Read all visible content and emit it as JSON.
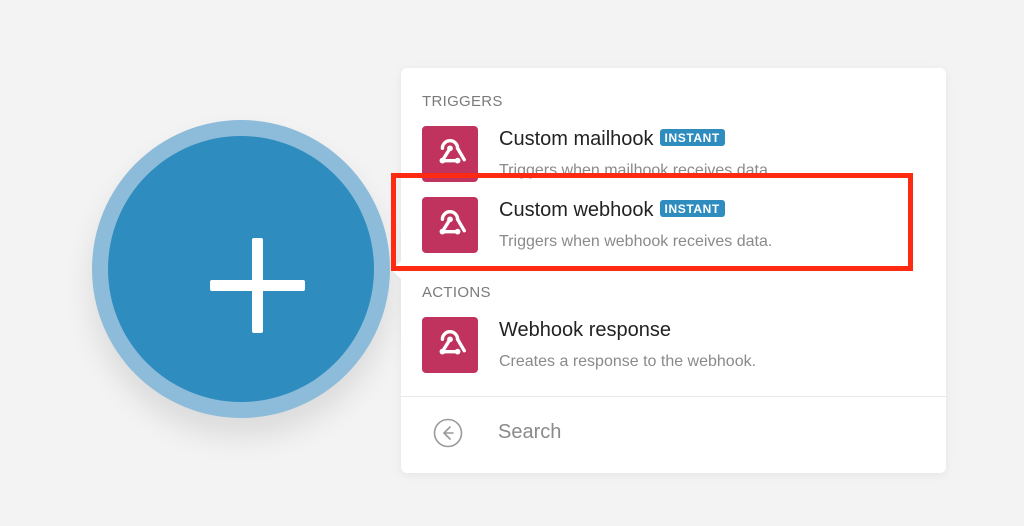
{
  "add_button": {
    "icon": "plus-icon"
  },
  "menu": {
    "triggers_label": "TRIGGERS",
    "actions_label": "ACTIONS",
    "triggers": [
      {
        "title": "Custom mailhook",
        "badge": "INSTANT",
        "description": "Triggers when mailhook receives data.",
        "icon": "webhook-icon"
      },
      {
        "title": "Custom webhook",
        "badge": "INSTANT",
        "description": "Triggers when webhook receives data.",
        "icon": "webhook-icon"
      }
    ],
    "actions": [
      {
        "title": "Webhook response",
        "description": "Creates a response to the webhook.",
        "icon": "webhook-icon"
      }
    ]
  },
  "search": {
    "placeholder": "Search",
    "back_icon": "arrow-left-circle-icon"
  },
  "colors": {
    "accent": "#2f8cbf",
    "accent_ring": "#8dbcda",
    "app_icon_bg": "#c0335f",
    "highlight": "#ff2a12"
  }
}
